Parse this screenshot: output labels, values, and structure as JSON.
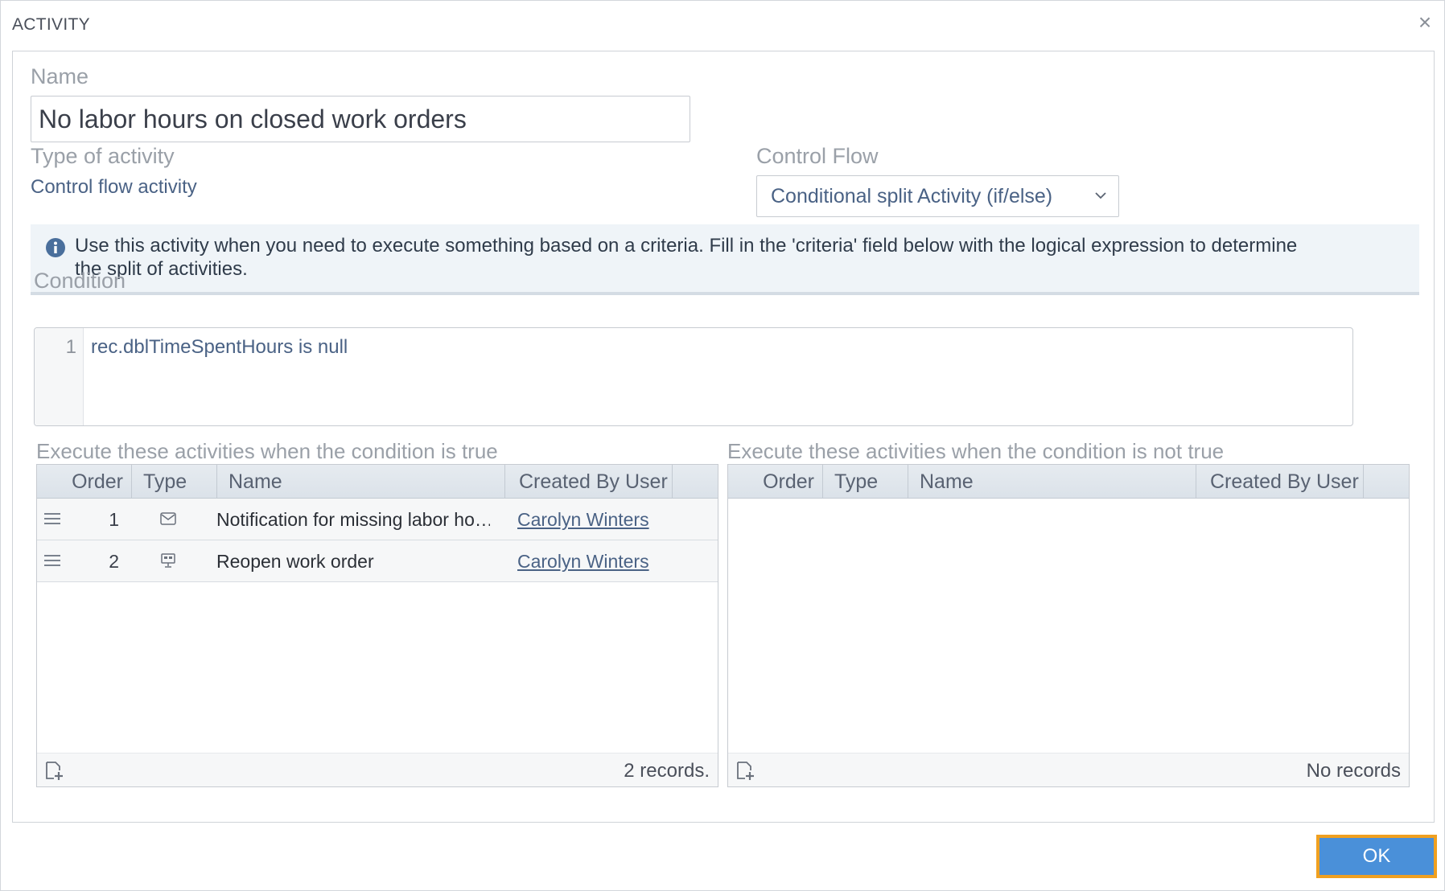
{
  "dialog": {
    "title": "ACTIVITY",
    "close_symbol": "×"
  },
  "name_field": {
    "label": "Name",
    "value": "No labor hours on closed work orders"
  },
  "type_field": {
    "label": "Type of activity",
    "value": "Control flow activity"
  },
  "control_flow": {
    "label": "Control Flow",
    "selected": "Conditional split Activity (if/else)"
  },
  "info": {
    "icon": "info-icon",
    "text": "Use this activity when you need to execute something based on a criteria. Fill in the 'criteria' field below with the logical expression to determine the split of activities."
  },
  "condition": {
    "label": "Condition",
    "line_number": "1",
    "code": "rec.dblTimeSpentHours is null"
  },
  "true_grid": {
    "label": "Execute these activities when the condition is true",
    "columns": {
      "order": "Order",
      "type": "Type",
      "name": "Name",
      "created_by": "Created By User"
    },
    "rows": [
      {
        "order": "1",
        "type_icon": "envelope-icon",
        "name": "Notification for missing labor ho…",
        "created_by": "Carolyn Winters"
      },
      {
        "order": "2",
        "type_icon": "workflow-icon",
        "name": "Reopen work order",
        "created_by": "Carolyn Winters"
      }
    ],
    "footer": "2 records."
  },
  "false_grid": {
    "label": "Execute these activities when the condition is not true",
    "columns": {
      "order": "Order",
      "type": "Type",
      "name": "Name",
      "created_by": "Created By User"
    },
    "rows": [],
    "footer": "No records"
  },
  "ok_button": {
    "label": "OK"
  },
  "colors": {
    "accent": "#4a90d9",
    "focus_ring": "#f0a020",
    "link": "#4a6285"
  }
}
